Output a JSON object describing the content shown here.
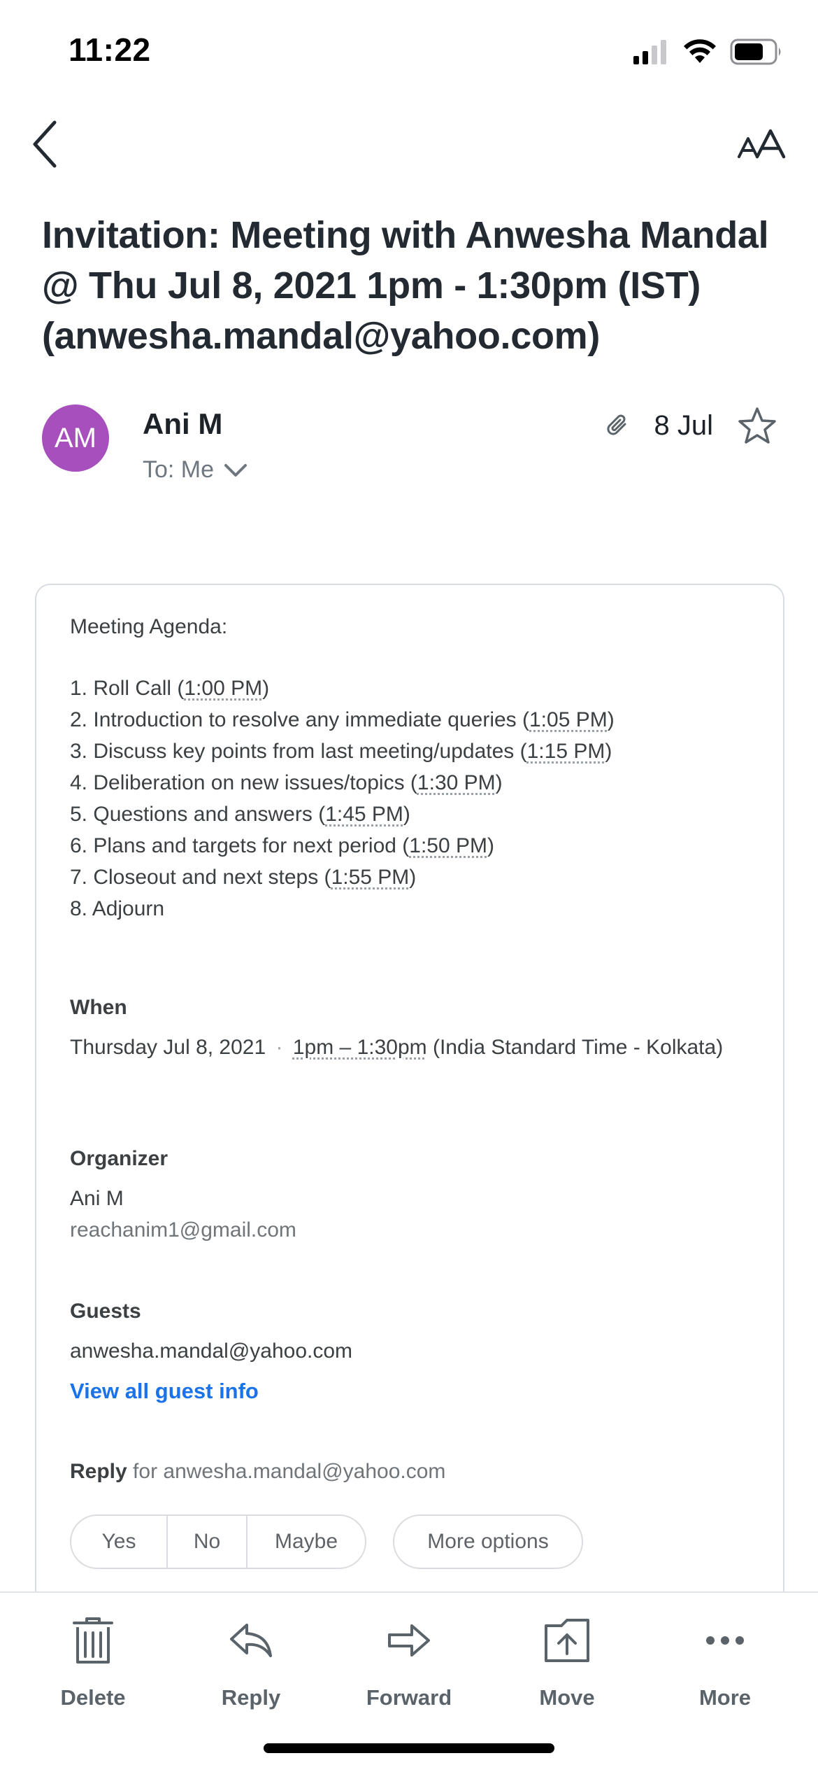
{
  "status_bar": {
    "time": "11:22",
    "icons": [
      "cellular-signal-icon",
      "wifi-icon",
      "battery-icon"
    ]
  },
  "nav": {
    "back_icon": "chevron-left-icon",
    "text_size_icon": "text-size-icon"
  },
  "email": {
    "subject": "Invitation: Meeting with Anwesha Mandal @ Thu Jul 8, 2021 1pm - 1:30pm (IST) (anwesha.mandal@yahoo.com)",
    "sender_initials": "AM",
    "sender_name": "Ani M",
    "recipient": "To: Me",
    "date": "8 Jul",
    "has_attachment": true,
    "starred": false
  },
  "invitation": {
    "agenda_title": "Meeting Agenda:",
    "agenda": [
      {
        "text": "1. Roll Call (",
        "time": "1:00 PM",
        "suffix": ")"
      },
      {
        "text": "2. Introduction to resolve any immediate queries (",
        "time": "1:05 PM",
        "suffix": ")"
      },
      {
        "text": "3. Discuss key points from last meeting/updates (",
        "time": "1:15 PM",
        "suffix": ")"
      },
      {
        "text": "4. Deliberation on new issues/topics (",
        "time": "1:30 PM",
        "suffix": ")"
      },
      {
        "text": "5. Questions and answers (",
        "time": "1:45 PM",
        "suffix": ")"
      },
      {
        "text": "6. Plans and targets for next period (",
        "time": "1:50 PM",
        "suffix": ")"
      },
      {
        "text": "7. Closeout and next steps (",
        "time": "1:55 PM",
        "suffix": ")"
      },
      {
        "text": "8. Adjourn",
        "time": "",
        "suffix": ""
      }
    ],
    "when": {
      "heading": "When",
      "date": "Thursday Jul 8, 2021",
      "separator": "·",
      "time_range": "1pm – 1:30pm",
      "timezone": "(India Standard Time - Kolkata)"
    },
    "organizer": {
      "heading": "Organizer",
      "name": "Ani M",
      "email": "reachanim1@gmail.com"
    },
    "guests": {
      "heading": "Guests",
      "email": "anwesha.mandal@yahoo.com",
      "view_all": "View all guest info"
    },
    "reply": {
      "label": "Reply",
      "for_text": "for anwesha.mandal@yahoo.com",
      "yes": "Yes",
      "no": "No",
      "maybe": "Maybe",
      "more_options": "More options"
    }
  },
  "toolbar": {
    "delete": "Delete",
    "reply": "Reply",
    "forward": "Forward",
    "move": "Move",
    "more": "More"
  },
  "colors": {
    "avatar": "#a74fbd",
    "link": "#1a73e8",
    "toolbar_icon": "#5b636a"
  }
}
